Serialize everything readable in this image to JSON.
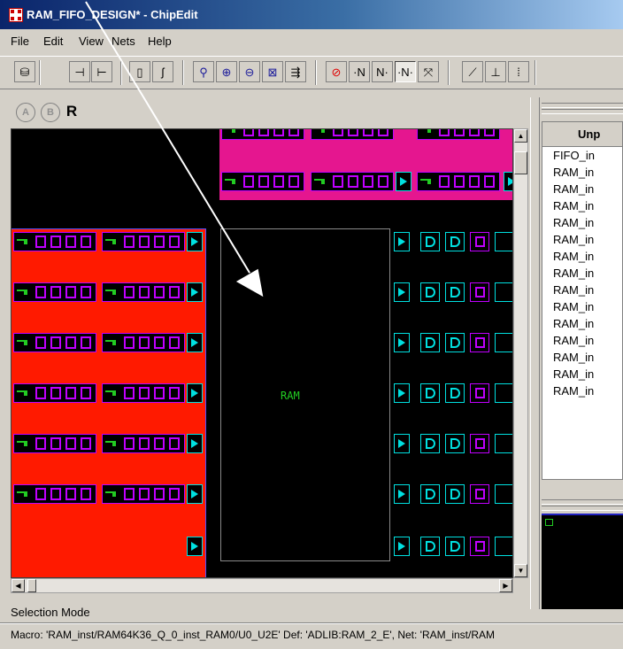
{
  "window": {
    "title": "RAM_FIFO_DESIGN* - ChipEdit"
  },
  "menu": {
    "items": [
      "File",
      "Edit",
      "View",
      "Nets",
      "Help"
    ]
  },
  "toolbar": {
    "buttons": [
      {
        "name": "database-icon",
        "glyph": "⛁"
      },
      {
        "name": "in-port-icon",
        "glyph": "⊣"
      },
      {
        "name": "out-port-icon",
        "glyph": "⊢"
      },
      {
        "name": "lock-icon",
        "glyph": "▯"
      },
      {
        "name": "unlock-icon",
        "glyph": "ʃ"
      },
      {
        "name": "zoom-select-icon",
        "glyph": "⚲"
      },
      {
        "name": "zoom-in-icon",
        "glyph": "⊕"
      },
      {
        "name": "zoom-out-icon",
        "glyph": "⊖"
      },
      {
        "name": "fit-view-icon",
        "glyph": "⊠"
      },
      {
        "name": "export-icon",
        "glyph": "⇶"
      },
      {
        "name": "no-nets-icon",
        "glyph": "⊘"
      },
      {
        "name": "net-n1-icon",
        "glyph": "·N"
      },
      {
        "name": "net-n2-icon",
        "glyph": "N·"
      },
      {
        "name": "net-n3-icon",
        "glyph": "·N·"
      },
      {
        "name": "ratsnest-icon",
        "glyph": "⤧"
      },
      {
        "name": "route-icon",
        "glyph": "⟋"
      },
      {
        "name": "pin-icon",
        "glyph": "⊥"
      },
      {
        "name": "grid-icon",
        "glyph": "⁞"
      }
    ],
    "active_index": 13,
    "accent_red": "#e00000"
  },
  "side_buttons": {
    "a_label": "A",
    "b_label": "B",
    "r_label": "R"
  },
  "canvas": {
    "ram_label": "RAM",
    "colors": {
      "background": "#000000",
      "red_block": "#ff1a00",
      "magenta_block": "#e5168f",
      "cell_outline": "#c000ff",
      "cyan_cell": "#00e0e0",
      "green_icon": "#22cc22",
      "block_border": "#5050ff"
    }
  },
  "right_panel": {
    "header": "Unp",
    "items": [
      "FIFO_in",
      "RAM_in",
      "RAM_in",
      "RAM_in",
      "RAM_in",
      "RAM_in",
      "RAM_in",
      "RAM_in",
      "RAM_in",
      "RAM_in",
      "RAM_in",
      "RAM_in",
      "RAM_in",
      "RAM_in",
      "RAM_in"
    ]
  },
  "status": {
    "mode": "Selection Mode",
    "details": "Macro: 'RAM_inst/RAM64K36_Q_0_inst_RAM0/U0_U2E' Def: 'ADLIB:RAM_2_E', Net: 'RAM_inst/RAM"
  }
}
